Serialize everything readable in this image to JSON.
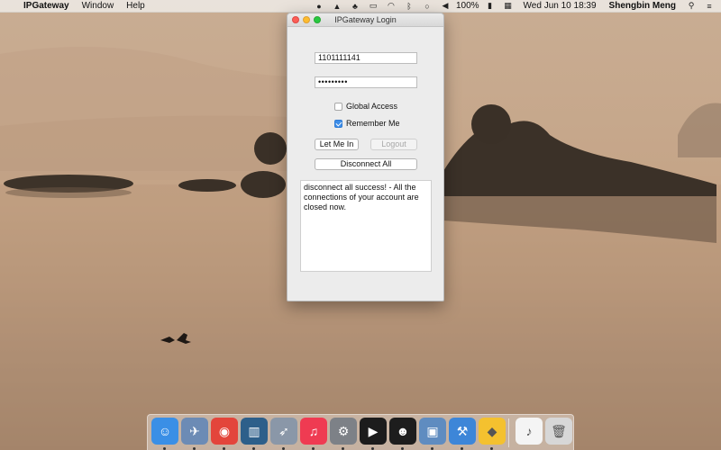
{
  "menubar": {
    "apple_glyph": "",
    "app_name": "IPGateway",
    "menus": [
      "Window",
      "Help"
    ],
    "battery": "100%",
    "datetime": "Wed Jun 10  18:39",
    "user": "Shengbin Meng",
    "status_icons": [
      "qq-icon",
      "app-icon",
      "wechat-icon",
      "display-icon",
      "wifi-icon",
      "bluetooth-icon",
      "chat-icon",
      "volume-icon",
      "battery-icon",
      "flag-icon"
    ]
  },
  "window": {
    "title": "IPGateway Login",
    "username_value": "1101111141",
    "password_value": "•••••••••",
    "global_access_label": "Global Access",
    "global_access_checked": false,
    "remember_me_label": "Remember Me",
    "remember_me_checked": true,
    "let_me_in_label": "Let Me In",
    "logout_label": "Logout",
    "disconnect_all_label": "Disconnect All",
    "message": "disconnect all success! - All the connections of your account are closed now."
  },
  "dock": {
    "items": [
      {
        "name": "finder-icon",
        "color": "#3a8fe6"
      },
      {
        "name": "preview-icon",
        "color": "#6c8bb5"
      },
      {
        "name": "chrome-icon",
        "color": "#e3453b"
      },
      {
        "name": "mission-control-icon",
        "color": "#2d5f8a"
      },
      {
        "name": "launchpad-icon",
        "color": "#8a97a8"
      },
      {
        "name": "itunes-icon",
        "color": "#ef3b52"
      },
      {
        "name": "system-preferences-icon",
        "color": "#7d8187"
      },
      {
        "name": "terminal-icon",
        "color": "#1c1c1c"
      },
      {
        "name": "qq-icon",
        "color": "#1d1d1d"
      },
      {
        "name": "image-capture-icon",
        "color": "#5f8cc0"
      },
      {
        "name": "xcode-icon",
        "color": "#3d86d8"
      },
      {
        "name": "sketch-icon",
        "color": "#f4c12f"
      },
      {
        "name": "music-file-icon",
        "color": "#f4f4f4"
      },
      {
        "name": "trash-icon",
        "color": "#d7d7d7"
      }
    ]
  }
}
